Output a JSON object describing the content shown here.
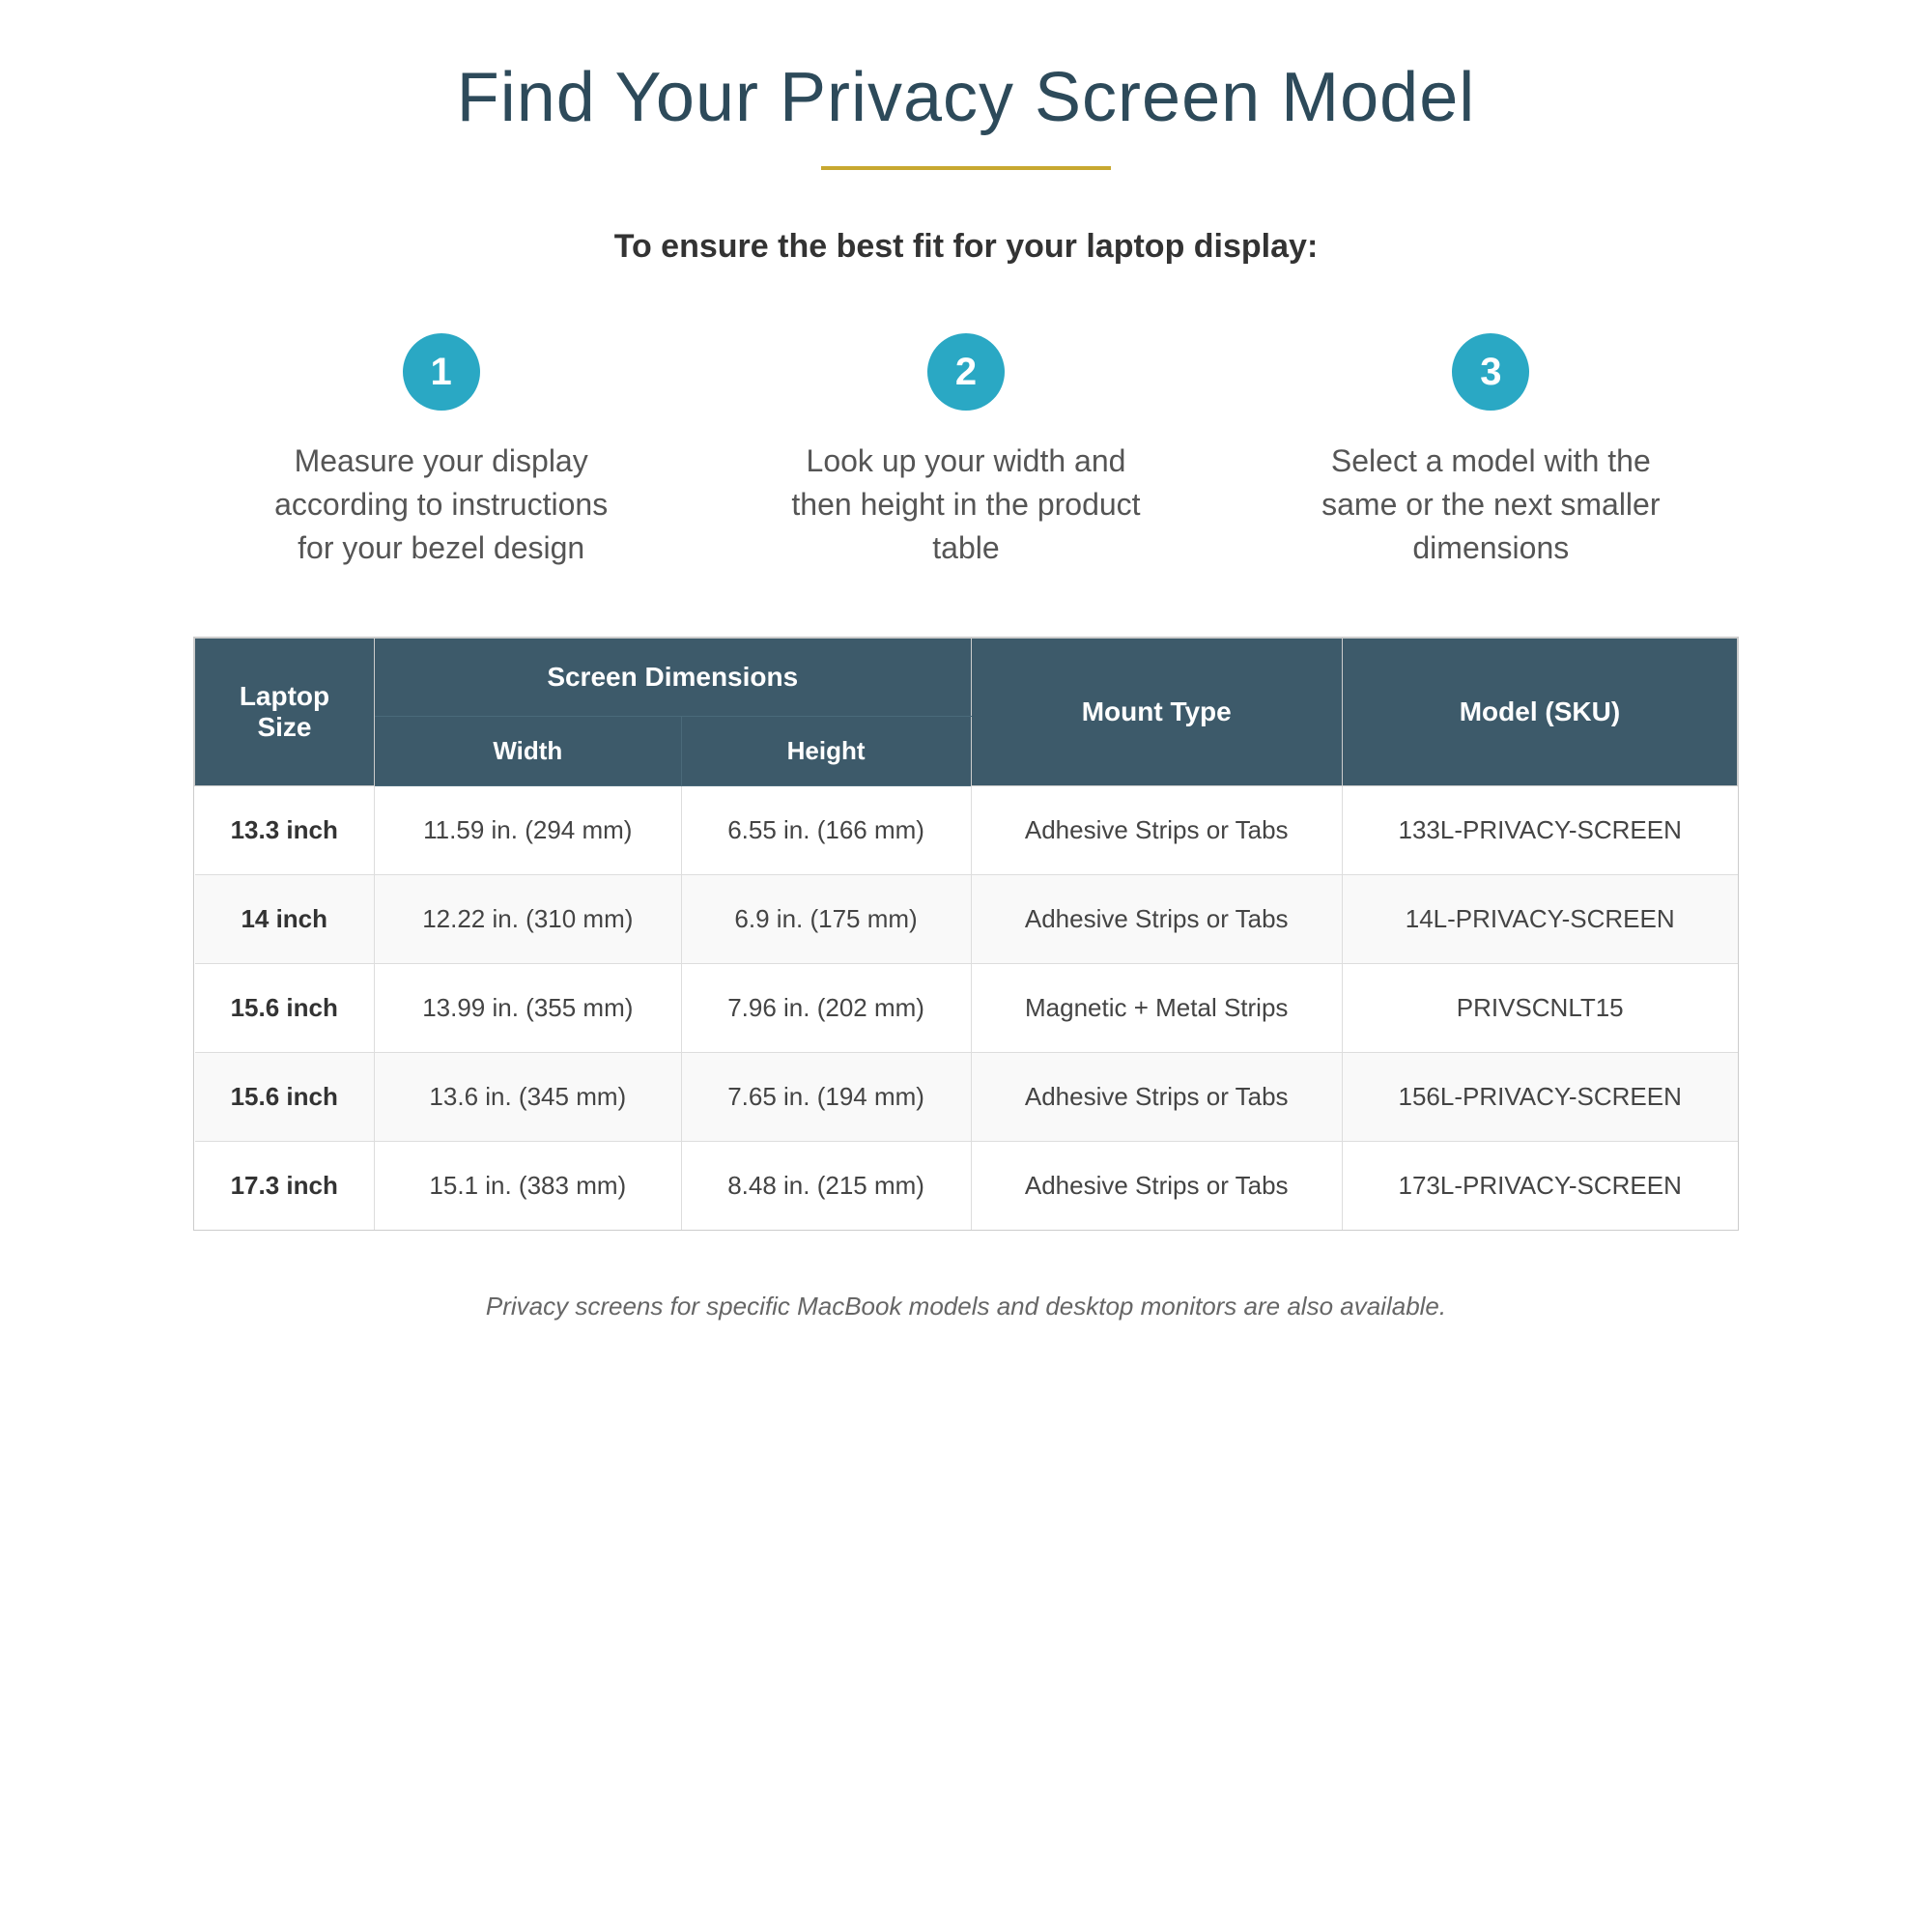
{
  "page": {
    "title": "Find Your Privacy Screen Model",
    "divider_color": "#c8a830",
    "subtitle": "To ensure the best fit for your laptop display:",
    "steps": [
      {
        "number": "1",
        "text": "Measure your display according to instructions for your bezel design"
      },
      {
        "number": "2",
        "text": "Look up your width and then height in the product table"
      },
      {
        "number": "3",
        "text": "Select a model with the same or the next smaller dimensions"
      }
    ],
    "table": {
      "col_laptop": "Laptop\nSize",
      "col_screen_dim": "Screen Dimensions",
      "col_width": "Width",
      "col_height": "Height",
      "col_mount": "Mount Type",
      "col_model": "Model (SKU)",
      "rows": [
        {
          "laptop_size": "13.3 inch",
          "width": "11.59 in. (294 mm)",
          "height": "6.55 in. (166 mm)",
          "mount": "Adhesive Strips or Tabs",
          "model": "133L-PRIVACY-SCREEN"
        },
        {
          "laptop_size": "14 inch",
          "width": "12.22 in. (310 mm)",
          "height": "6.9 in. (175 mm)",
          "mount": "Adhesive Strips or Tabs",
          "model": "14L-PRIVACY-SCREEN"
        },
        {
          "laptop_size": "15.6 inch",
          "width": "13.99 in. (355 mm)",
          "height": "7.96 in. (202 mm)",
          "mount": "Magnetic + Metal Strips",
          "model": "PRIVSCNLT15"
        },
        {
          "laptop_size": "15.6 inch",
          "width": "13.6 in. (345 mm)",
          "height": "7.65 in. (194 mm)",
          "mount": "Adhesive Strips or Tabs",
          "model": "156L-PRIVACY-SCREEN"
        },
        {
          "laptop_size": "17.3 inch",
          "width": "15.1 in. (383 mm)",
          "height": "8.48 in. (215 mm)",
          "mount": "Adhesive Strips or Tabs",
          "model": "173L-PRIVACY-SCREEN"
        }
      ]
    },
    "footnote": "Privacy screens for specific MacBook models and desktop monitors are also available."
  }
}
